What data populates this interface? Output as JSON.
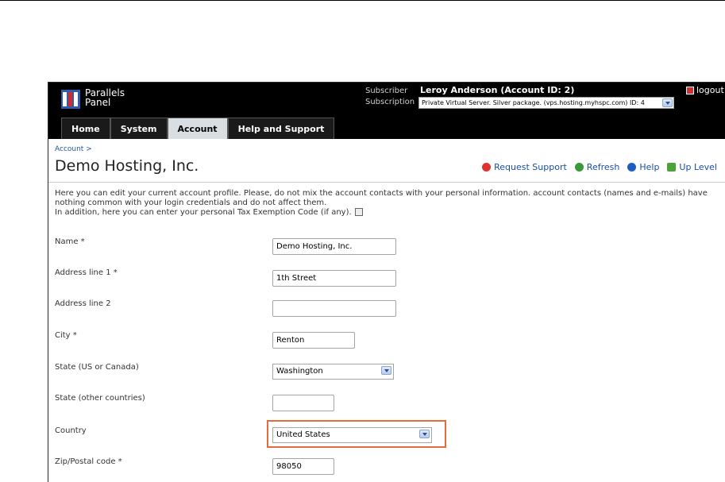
{
  "header": {
    "logo_line1": "Parallels",
    "logo_line2": "Panel",
    "subscriber_label": "Subscriber",
    "subscription_label": "Subscription",
    "subscriber_name": "Leroy Anderson (Account ID: 2)",
    "subscription_value": "Private Virtual Server. Silver package. (vps.hosting.myhspc.com) ID: 4",
    "logout_label": "logout"
  },
  "tabs": [
    {
      "label": "Home"
    },
    {
      "label": "System"
    },
    {
      "label": "Account"
    },
    {
      "label": "Help and Support"
    }
  ],
  "breadcrumb": "Account >",
  "page_title": "Demo Hosting, Inc.",
  "actions": {
    "request_support": "Request Support",
    "refresh": "Refresh",
    "help": "Help",
    "up_level": "Up Level"
  },
  "intro": {
    "line1": "Here you can edit your current account profile. Please, do not mix the account contacts with your personal information. account contacts (names and e-mails) have",
    "line2": "nothing common with your login credentials and do not affect them.",
    "line3": "In addition, here you can enter your personal Tax Exemption Code (if any)."
  },
  "form": {
    "name_label": "Name *",
    "name_value": "Demo Hosting, Inc.",
    "address1_label": "Address line 1 *",
    "address1_value": "1th Street",
    "address2_label": "Address line 2",
    "address2_value": "",
    "city_label": "City *",
    "city_value": "Renton",
    "state_us_label": "State (US or Canada)",
    "state_us_value": "Washington",
    "state_other_label": "State (other countries)",
    "state_other_value": "",
    "country_label": "Country",
    "country_value": "United States",
    "zip_label": "Zip/Postal code *",
    "zip_value": "98050"
  },
  "colors": {
    "header_bg": "#000000",
    "link": "#1a4fa0",
    "highlight": "#e56b3d"
  }
}
